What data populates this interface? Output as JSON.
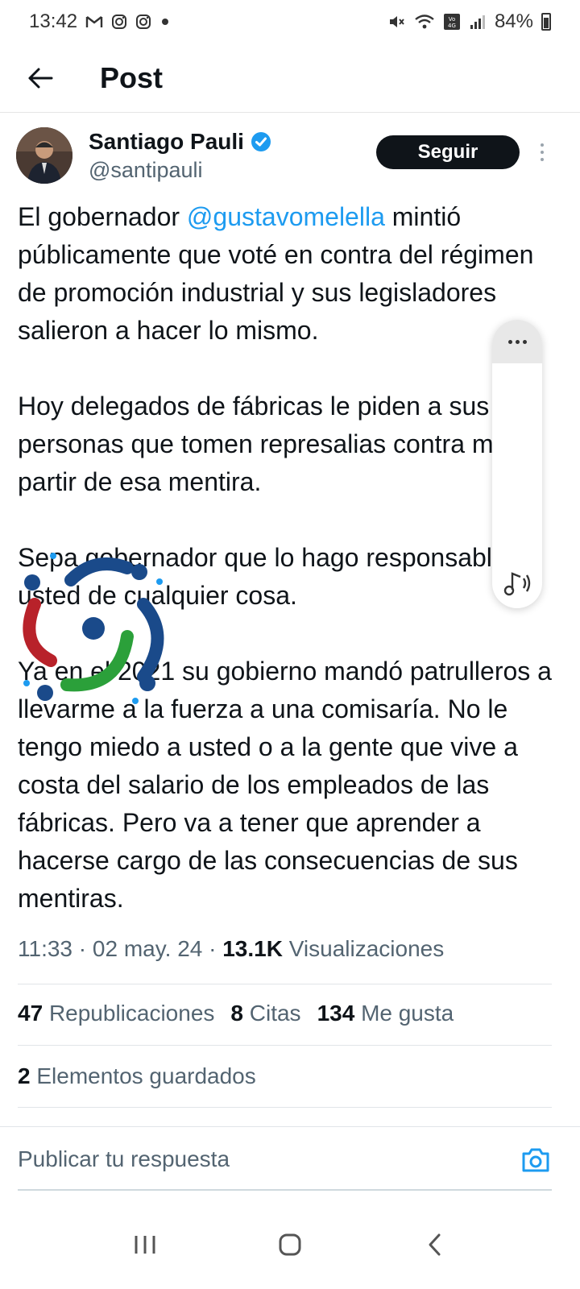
{
  "status_bar": {
    "time": "13:42",
    "battery_percent": "84%",
    "left_icons": [
      "gmail-icon",
      "instagram-icon",
      "instagram-icon",
      "dot-icon"
    ],
    "right_icons": [
      "mute-icon",
      "wifi-icon",
      "volte-icon",
      "signal-icon",
      "battery-icon"
    ]
  },
  "header": {
    "title": "Post"
  },
  "author": {
    "name": "Santiago Pauli",
    "handle": "@santipauli",
    "verified": true,
    "follow_label": "Seguir"
  },
  "tweet": {
    "p1_before": "El gobernador ",
    "p1_mention": "@gustavomelella",
    "p1_after": " mintió públicamente que voté en contra del régimen de promoción industrial y sus legisladores salieron a hacer lo mismo.",
    "p2": "Hoy delegados de fábricas le piden a sus personas que tomen represalias contra mí a partir de esa mentira.",
    "p3": "Sepa gobernador que lo hago responsable a usted de cualquier cosa.",
    "p4": "Ya en el 2021 su gobierno mandó patrulleros a llevarme a la fuerza a una comisaría. No le tengo miedo a usted o a la gente que vive a costa del salario de los empleados de las fábricas. Pero va a tener que aprender a hacerse cargo de las consecuencias de sus mentiras."
  },
  "meta": {
    "time": "11:33",
    "date": "02 may. 24",
    "views_count": "13.1K",
    "views_label": "Visualizaciones",
    "separator": "·"
  },
  "stats": {
    "reposts_count": "47",
    "reposts_label": "Republicaciones",
    "quotes_count": "8",
    "quotes_label": "Citas",
    "likes_count": "134",
    "likes_label": "Me gusta",
    "bookmarks_count": "2",
    "bookmarks_label": "Elementos guardados"
  },
  "reply": {
    "placeholder": "Publicar tu respuesta"
  },
  "colors": {
    "accent": "#1d9bf0",
    "text_primary": "#0f1419",
    "text_secondary": "#536471",
    "follow_bg": "#0f1419"
  }
}
